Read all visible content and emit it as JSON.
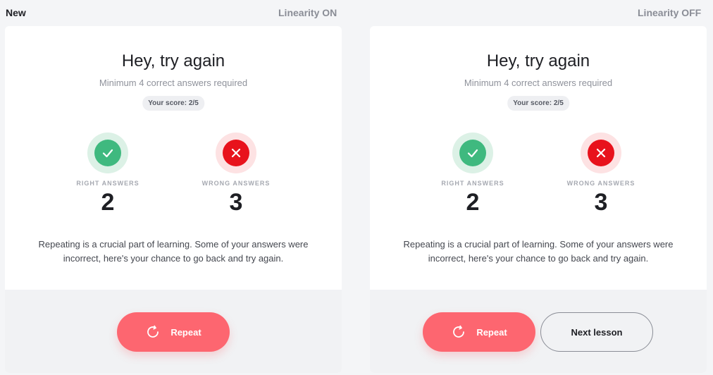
{
  "header": {
    "new_label": "New",
    "left_mode": "Linearity ON",
    "right_mode": "Linearity OFF"
  },
  "panels": [
    {
      "title": "Hey, try again",
      "subtitle": "Minimum 4 correct answers required",
      "score": "Your score: 2/5",
      "right_label": "RIGHT ANSWERS",
      "right_value": "2",
      "wrong_label": "WRONG ANSWERS",
      "wrong_value": "3",
      "message": "Repeating is a crucial part of learning. Some of your answers were incorrect, here's your chance to go back and try again.",
      "repeat_label": "Repeat"
    },
    {
      "title": "Hey, try again",
      "subtitle": "Minimum 4 correct answers required",
      "score": "Your score: 2/5",
      "right_label": "RIGHT ANSWERS",
      "right_value": "2",
      "wrong_label": "WRONG ANSWERS",
      "wrong_value": "3",
      "message": "Repeating is a crucial part of learning. Some of your answers were incorrect, here's your chance to go back and try again.",
      "repeat_label": "Repeat",
      "next_label": "Next lesson"
    }
  ],
  "icons": {
    "right": "check-icon",
    "wrong": "close-icon",
    "repeat": "repeat-icon"
  },
  "colors": {
    "accent": "#fd6670",
    "success": "#3fb97f",
    "error": "#e8121c"
  }
}
